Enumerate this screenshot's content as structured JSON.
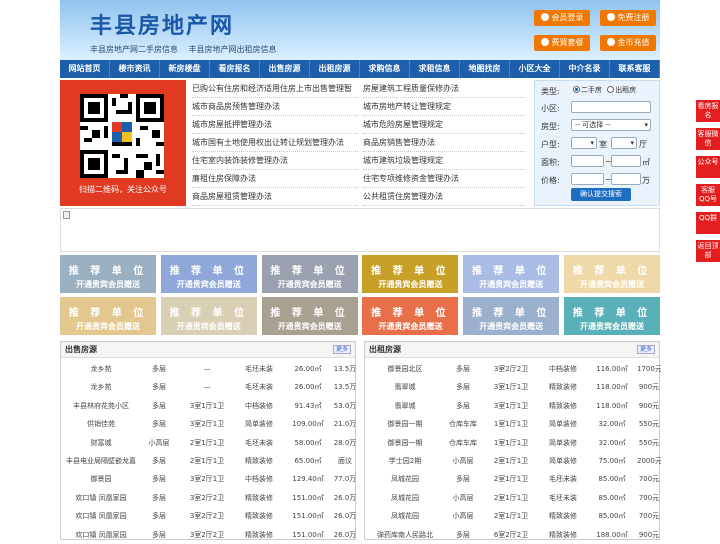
{
  "header": {
    "title": "丰县房地产网",
    "subtitle": [
      "丰县房地产网二手房信息",
      "丰县房地产网出租房信息"
    ],
    "buttons": [
      {
        "label": "会员登录"
      },
      {
        "label": "免费注册"
      },
      {
        "label": "费買套餐"
      },
      {
        "label": "金币充值"
      }
    ]
  },
  "nav": [
    "网站首页",
    "楼市资讯",
    "新房楼盘",
    "看房报名",
    "出售房源",
    "出租房源",
    "求购信息",
    "求租信息",
    "地图找房",
    "小区大全",
    "中介名录",
    "联系客服"
  ],
  "qr": {
    "caption": "扫描二维码，关注公众号"
  },
  "notices": [
    [
      "已购公有住房和经济适用住房上市出售管理暂",
      "房屋建筑工程质量保修办法"
    ],
    [
      "城市商品房预售管理办法",
      "城市房地产转让管理规定"
    ],
    [
      "城市房屋抵押管理办法",
      "城市危险房屋管理规定"
    ],
    [
      "城市国有土地使用权出让转让规划管理办法",
      "商品房销售管理办法"
    ],
    [
      "住宅室内装饰装修管理办法",
      "城市建筑垃圾管理规定"
    ],
    [
      "廉租住房保障办法",
      "住宅专项维修资金管理办法"
    ],
    [
      "商品房屋租赁管理办法",
      "公共租赁住房管理办法"
    ]
  ],
  "search": {
    "type_label": "类型:",
    "opt1": "二手房",
    "opt2": "出租房",
    "xq_label": "小区:",
    "fx_label": "房型:",
    "fx_select": "-- 可选择 --",
    "hx_label": "户型:",
    "room": "室",
    "hall": "厅",
    "area_label": "面积:",
    "area_unit": "㎡",
    "price_label": "价格:",
    "price_unit": "万",
    "button": "确认提交搜索"
  },
  "promo": {
    "line1": "推 荐 单 位",
    "line2": "开通贵宾会员赠送",
    "colors": [
      "#9ab0c0",
      "#8fa8d9",
      "#9aa0b0",
      "#c7a028",
      "#a9bde4",
      "#efd9a8",
      "#e4c78e",
      "#d9cfb4",
      "#a8a090",
      "#e7704a",
      "#9ab0cc",
      "#5ab0b8"
    ]
  },
  "sale": {
    "title": "出售房源",
    "more": "更多",
    "rows": [
      [
        "龙乡苑",
        "多层",
        "—",
        "毛坯未装",
        "26.00㎡",
        "13.5万"
      ],
      [
        "龙乡苑",
        "多层",
        "—",
        "毛坯未装",
        "26.00㎡",
        "13.5万"
      ],
      [
        "丰县林府花苑小区",
        "多层",
        "3室1厅1卫",
        "中档装修",
        "91.43㎡",
        "53.0万"
      ],
      [
        "供销佳苑",
        "多层",
        "3室2厅1卫",
        "简单装修",
        "109.00㎡",
        "21.0万"
      ],
      [
        "财富城",
        "小高层",
        "2室1厅1卫",
        "毛坯未装",
        "58.00㎡",
        "28.0万"
      ],
      [
        "丰县电业局隔壁嵌龙嘉",
        "多层",
        "2室1厅1卫",
        "精致装修",
        "65.00㎡",
        "面议"
      ],
      [
        "御景园",
        "多层",
        "3室2厅1卫",
        "中档装修",
        "129.40㎡",
        "77.0万"
      ],
      [
        "欢口镇 凤凰家园",
        "多层",
        "3室2厅2卫",
        "精致装修",
        "151.00㎡",
        "26.0万"
      ],
      [
        "欢口镇 凤凰家园",
        "多层",
        "3室2厅2卫",
        "精致装修",
        "151.00㎡",
        "26.0万"
      ],
      [
        "欢口镇 凤凰家园",
        "多层",
        "3室2厅2卫",
        "精致装修",
        "151.00㎡",
        "26.0万"
      ]
    ]
  },
  "rent": {
    "title": "出租房源",
    "more": "更多",
    "rows": [
      [
        "御景园北区",
        "多层",
        "3室2厅2卫",
        "中档装修",
        "116.00㎡",
        "1700元"
      ],
      [
        "翡翠城",
        "多层",
        "3室1厅1卫",
        "精致装修",
        "118.00㎡",
        "900元"
      ],
      [
        "翡翠城",
        "多层",
        "3室1厅1卫",
        "精致装修",
        "118.00㎡",
        "900元"
      ],
      [
        "御景园一期",
        "仓库车库",
        "1室1厅1卫",
        "简单装修",
        "32.00㎡",
        "550元"
      ],
      [
        "御景园一期",
        "仓库车库",
        "1室1厅1卫",
        "简单装修",
        "32.00㎡",
        "550元"
      ],
      [
        "学士园2期",
        "小高层",
        "2室1厅1卫",
        "简单装修",
        "75.00㎡",
        "2000元"
      ],
      [
        "凤城花园",
        "多层",
        "2室1厅1卫",
        "毛坯未装",
        "85.00㎡",
        "700元"
      ],
      [
        "凤城花园",
        "小高层",
        "2室1厅1卫",
        "毛坯未装",
        "85.00㎡",
        "700元"
      ],
      [
        "凤城花园",
        "小高层",
        "2室1厅1卫",
        "精致装修",
        "85.00㎡",
        "700元"
      ],
      [
        "弹药库南人民路北",
        "多层",
        "6室2厅2卫",
        "精致装修",
        "188.00㎡",
        "900元"
      ]
    ]
  },
  "sidebar": [
    "看房报名",
    "客服微信",
    "公众号",
    "客服QQ号",
    "QQ群",
    "返回顶部"
  ]
}
